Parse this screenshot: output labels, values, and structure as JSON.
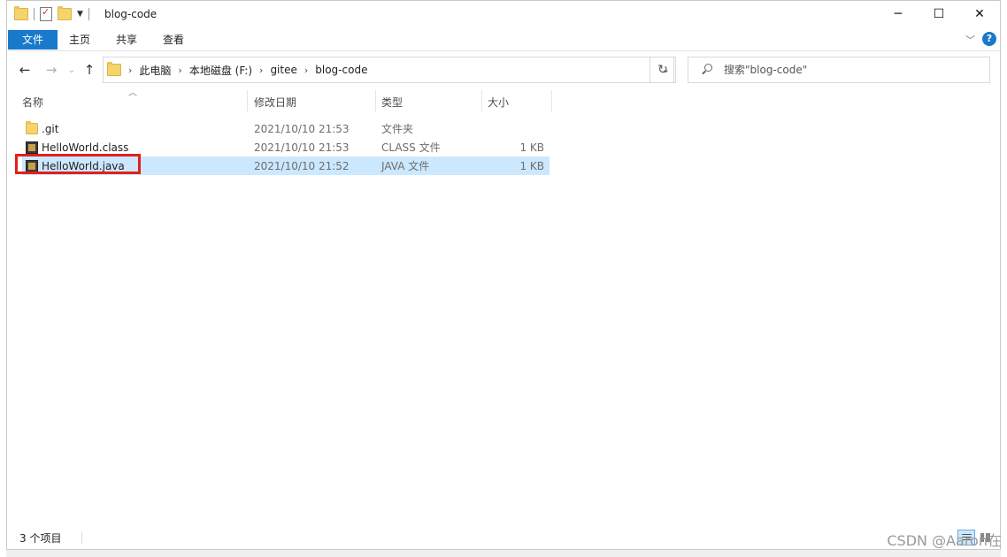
{
  "window": {
    "title": "blog-code"
  },
  "ribbon": {
    "tabs": [
      "文件",
      "主页",
      "共享",
      "查看"
    ],
    "help": "?"
  },
  "nav": {
    "breadcrumb": [
      "此电脑",
      "本地磁盘 (F:)",
      "gitee",
      "blog-code"
    ],
    "search_placeholder": "搜索\"blog-code\""
  },
  "columns": {
    "name": "名称",
    "modified": "修改日期",
    "type": "类型",
    "size": "大小"
  },
  "files": [
    {
      "name": ".git",
      "modified": "2021/10/10 21:53",
      "type": "文件夹",
      "size": "",
      "icon": "folder-icon",
      "selected": false
    },
    {
      "name": "HelloWorld.class",
      "modified": "2021/10/10 21:53",
      "type": "CLASS 文件",
      "size": "1 KB",
      "icon": "class-file-icon",
      "selected": false
    },
    {
      "name": "HelloWorld.java",
      "modified": "2021/10/10 21:52",
      "type": "JAVA 文件",
      "size": "1 KB",
      "icon": "java-file-icon",
      "selected": true
    }
  ],
  "status": {
    "item_count": "3 个项目"
  },
  "colors": {
    "accent": "#1979ca",
    "selection": "#cce8ff",
    "highlight_box": "#e02020"
  },
  "watermark": "CSDN @Aaron在"
}
